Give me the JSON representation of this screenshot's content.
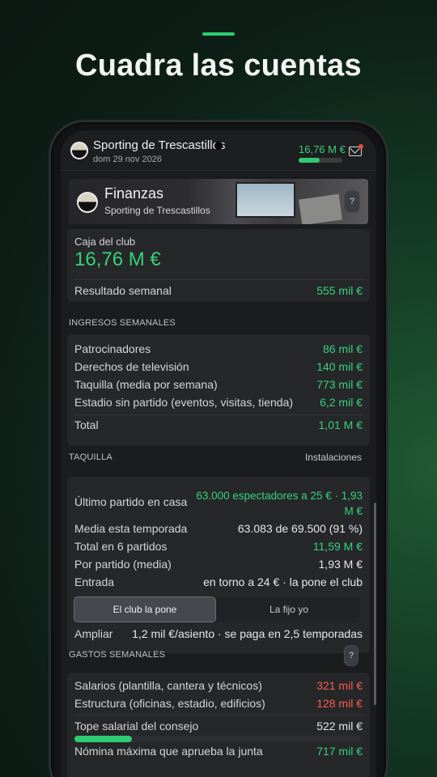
{
  "headline": "Cuadra las cuentas",
  "topbar": {
    "club_name": "Sporting de Trescastillos",
    "date": "dom 29 nov 2026",
    "money": "16,76 M €",
    "money_bar_fraction": 0.48
  },
  "banner": {
    "title": "Finanzas",
    "subtitle": "Sporting de Trescastillos",
    "help": "?"
  },
  "caja": {
    "label": "Caja del club",
    "value": "16,76 M €",
    "weekly_label": "Resultado semanal",
    "weekly_value": "555 mil €"
  },
  "ingresos": {
    "title": "INGRESOS SEMANALES",
    "rows": [
      {
        "label": "Patrocinadores",
        "value": "86 mil €"
      },
      {
        "label": "Derechos de televisión",
        "value": "140 mil €"
      },
      {
        "label": "Taquilla (media por semana)",
        "value": "773 mil €"
      },
      {
        "label": "Estadio sin partido (eventos, visitas, tienda)",
        "value": "6,2 mil €"
      }
    ],
    "total_label": "Total",
    "total_value": "1,01 M €"
  },
  "taquilla": {
    "title": "TAQUILLA",
    "link": "Instalaciones",
    "last_label": "Último partido en casa",
    "last_value_1": "63.000 espectadores a 25 € · 1,93",
    "last_value_2": "M €",
    "rows": [
      {
        "label": "Media esta temporada",
        "value": "63.083 de 69.500 (91 %)"
      },
      {
        "label": "Total en 6 partidos",
        "value": "11,59 M €"
      },
      {
        "label": "Por partido (media)",
        "value": "1,93 M €"
      },
      {
        "label": "Entrada",
        "value": "en torno a 24 € · la pone el club"
      }
    ],
    "option_club": "El club la pone",
    "option_self": "La fijo yo",
    "ampliar_label": "Ampliar",
    "ampliar_value": "1,2 mil €/asiento · se paga en 2,5 temporadas"
  },
  "gastos": {
    "title": "GASTOS SEMANALES",
    "help": "?",
    "rows": [
      {
        "label": "Salarios (plantilla, cantera y técnicos)",
        "value": "321 mil €"
      },
      {
        "label": "Estructura (oficinas, estadio, edificios)",
        "value": "128 mil €"
      }
    ],
    "cap_label": "Tope salarial del consejo",
    "cap_value": "522 mil €",
    "cap_fraction": 0.2,
    "max_label": "Nómina máxima que aprueba la junta",
    "max_value": "717 mil €"
  },
  "colors": {
    "accent": "#2ecc71",
    "positive": "#34d27b",
    "negative": "#ff5a4f",
    "background": "#1b1c1e"
  }
}
